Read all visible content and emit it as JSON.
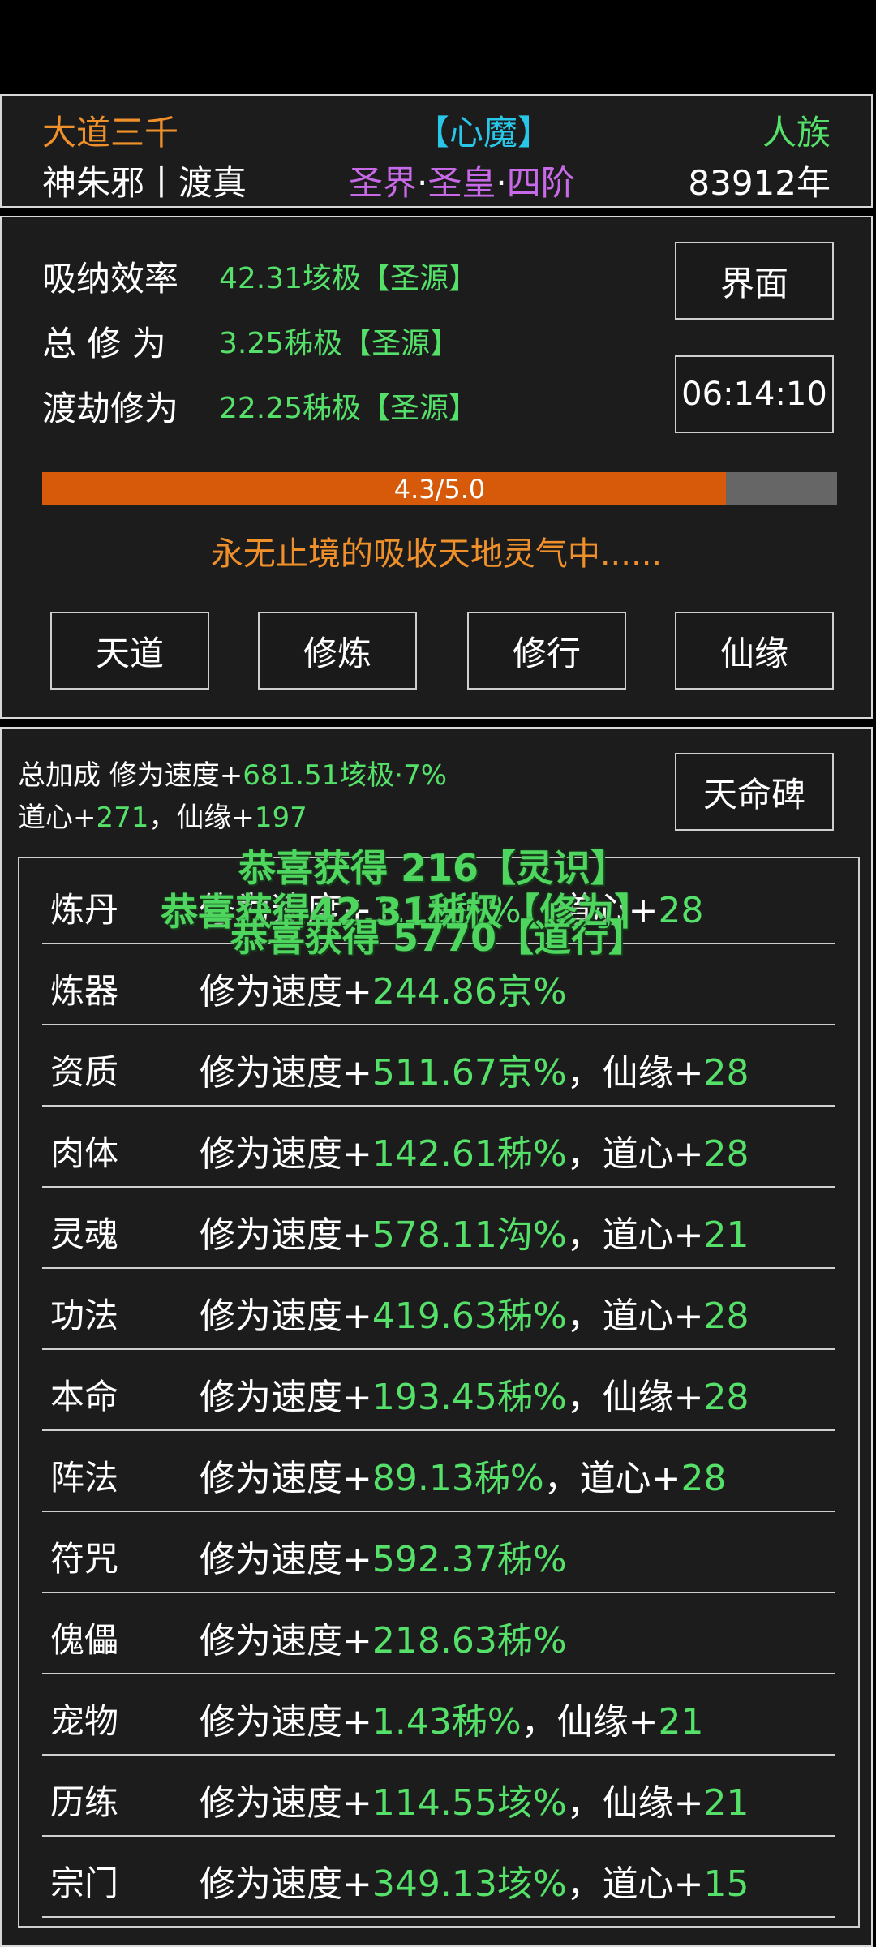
{
  "header": {
    "title": "大道三千",
    "status": "【心魔】",
    "race": "人族",
    "player": "神朱邪丨渡真",
    "realm_parts": [
      "圣界",
      "·",
      "圣皇",
      "·",
      "四阶"
    ],
    "years": "83912年"
  },
  "stats": {
    "absorb_label": "吸纳效率",
    "absorb_value": "42.31垓极【圣源】",
    "total_label": "总 修 为",
    "total_value": "3.25秭极【圣源】",
    "tribulation_label": "渡劫修为",
    "tribulation_value": "22.25秭极【圣源】",
    "interface_button": "界面",
    "timer": "06:14:10",
    "progress_text": "4.3/5.0",
    "progress_fraction": 0.86,
    "status_text": "永无止境的吸收天地灵气中......"
  },
  "actions": [
    "天道",
    "修炼",
    "修行",
    "仙缘"
  ],
  "bonus": {
    "label": "总加成 修为速度+",
    "speed": "681.51垓极·7%",
    "daoxin_label": "道心+",
    "daoxin": "271",
    "sep": "，仙缘+",
    "xianyuan": "197",
    "stele_button": "天命碑"
  },
  "rows": [
    {
      "name": "炼丹",
      "prefix": "修为速度+",
      "value": "1.18秭%",
      "sep": "，道心+",
      "extra": "28"
    },
    {
      "name": "炼器",
      "prefix": "修为速度+",
      "value": "244.86京%",
      "sep": "",
      "extra": ""
    },
    {
      "name": "资质",
      "prefix": "修为速度+",
      "value": "511.67京%",
      "sep": "，仙缘+",
      "extra": "28"
    },
    {
      "name": "肉体",
      "prefix": "修为速度+",
      "value": "142.61秭%",
      "sep": "，道心+",
      "extra": "28"
    },
    {
      "name": "灵魂",
      "prefix": "修为速度+",
      "value": "578.11沟%",
      "sep": "，道心+",
      "extra": "21"
    },
    {
      "name": "功法",
      "prefix": "修为速度+",
      "value": "419.63秭%",
      "sep": "，道心+",
      "extra": "28"
    },
    {
      "name": "本命",
      "prefix": "修为速度+",
      "value": "193.45秭%",
      "sep": "，仙缘+",
      "extra": "28"
    },
    {
      "name": "阵法",
      "prefix": "修为速度+",
      "value": "89.13秭%",
      "sep": "，道心+",
      "extra": "28"
    },
    {
      "name": "符咒",
      "prefix": "修为速度+",
      "value": "592.37秭%",
      "sep": "",
      "extra": ""
    },
    {
      "name": "傀儡",
      "prefix": "修为速度+",
      "value": "218.63秭%",
      "sep": "",
      "extra": ""
    },
    {
      "name": "宠物",
      "prefix": "修为速度+",
      "value": "1.43秭%",
      "sep": "，仙缘+",
      "extra": "21"
    },
    {
      "name": "历练",
      "prefix": "修为速度+",
      "value": "114.55垓%",
      "sep": "，仙缘+",
      "extra": "21"
    },
    {
      "name": "宗门",
      "prefix": "修为速度+",
      "value": "349.13垓%",
      "sep": "，道心+",
      "extra": "15"
    }
  ],
  "notifications": [
    "恭喜获得 216【灵识】",
    "恭喜获得42.31秭极【修为】",
    "恭喜获得 5770【道行】"
  ],
  "colors": {
    "orange": "#f0902a",
    "cyan": "#29c6e8",
    "green": "#55e06a",
    "purple": "#c86ae8",
    "progress": "#d65a0a"
  }
}
